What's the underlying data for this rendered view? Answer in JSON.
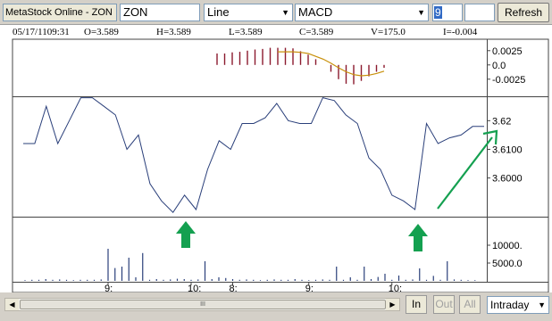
{
  "toolbar": {
    "app_title": "MetaStock Online - ZON",
    "symbol": "ZON",
    "chart_type": "Line",
    "indicator": "MACD",
    "period": "9",
    "refresh_label": "Refresh"
  },
  "info": {
    "datetime": "05/17/1109:31",
    "open": "O=3.589",
    "high": "H=3.589",
    "low": "L=3.589",
    "close": "C=3.589",
    "volume": "V=175.0",
    "indicator_value": "I=-0.004"
  },
  "icons": {
    "dropdown": "▼",
    "scroll_left": "◀",
    "scroll_right": "▶",
    "thumb_grip": "III"
  },
  "colors": {
    "macd_bars": "#8b1a2e",
    "signal_line": "#c8900a",
    "price_line": "#2a3f7a",
    "volume_bars": "#2a3f7a",
    "arrow_green": "#14a050"
  },
  "chart_data": [
    {
      "type": "bar",
      "panel": "MACD",
      "ylabels": [
        "0.0025",
        "0.0",
        "-0.0025"
      ],
      "yticks": [
        0.0025,
        0,
        -0.0025
      ],
      "ylim": [
        -0.0055,
        0.0045
      ],
      "x": [
        26,
        27,
        28,
        29,
        30,
        31,
        32,
        33,
        34,
        35,
        36,
        37,
        38,
        39,
        40,
        41,
        42,
        43,
        44,
        45,
        46,
        47,
        48
      ],
      "histogram": [
        0.002,
        0.002,
        0.0022,
        0.0023,
        0.0025,
        0.0027,
        0.0028,
        0.003,
        0.003,
        0.003,
        0.0029,
        0.0024,
        0.0018,
        0.001,
        0,
        -0.0012,
        -0.0025,
        -0.0033,
        -0.0034,
        -0.0028,
        -0.002,
        -0.0012,
        -0.0005
      ],
      "signal": [
        0.0023,
        0.0023,
        0.0023,
        0.0022,
        0.002,
        0.0015,
        0.001,
        0.0003,
        -0.0005,
        -0.0012,
        -0.0017,
        -0.0019,
        -0.0018,
        -0.0015,
        -0.0011
      ]
    },
    {
      "type": "line",
      "panel": "Price",
      "ylabels": [
        "3.62",
        "3.6100",
        "3.6000"
      ],
      "yticks": [
        3.62,
        3.61,
        3.6
      ],
      "ylim": [
        3.5865,
        3.6285
      ],
      "values": [
        3.612,
        3.612,
        3.625,
        3.612,
        3.62,
        3.628,
        3.628,
        3.625,
        3.622,
        3.61,
        3.615,
        3.598,
        3.592,
        3.588,
        3.594,
        3.589,
        3.603,
        3.613,
        3.61,
        3.619,
        3.619,
        3.621,
        3.626,
        3.62,
        3.619,
        3.619,
        3.628,
        3.627,
        3.622,
        3.619,
        3.607,
        3.603,
        3.594,
        3.592,
        3.589,
        3.619,
        3.612,
        3.614,
        3.615,
        3.618,
        3.618
      ],
      "trend_annotation": "uptrend-arrow"
    },
    {
      "type": "bar",
      "panel": "Volume",
      "ylabels": [
        "10000.",
        "5000.0"
      ],
      "yticks": [
        10000,
        5000
      ],
      "ylim": [
        0,
        18000
      ],
      "values": [
        200,
        300,
        300,
        500,
        300,
        400,
        300,
        200,
        300,
        300,
        300,
        400,
        9000,
        3600,
        4000,
        6500,
        1000,
        7800,
        300,
        500,
        300,
        400,
        600,
        500,
        300,
        400,
        5500,
        500,
        1000,
        800,
        500,
        300,
        400,
        300,
        200,
        300,
        400,
        300,
        300,
        500,
        300,
        200,
        300,
        400,
        300,
        4000,
        300,
        1000,
        300,
        4000,
        500,
        1100,
        2000,
        300,
        1500,
        300,
        400,
        3500,
        300,
        1400,
        300,
        5500,
        400,
        300,
        200,
        200
      ],
      "xlabels": [
        {
          "label": "9:",
          "i": 12
        },
        {
          "label": "10:",
          "i": 24
        },
        {
          "label": "8:",
          "i": 30
        },
        {
          "label": "9:",
          "i": 41
        },
        {
          "label": "10:",
          "i": 53
        }
      ]
    }
  ],
  "bottom": {
    "zoom_in": "In",
    "zoom_out": "Out",
    "zoom_all": "All",
    "interval": "Intraday"
  }
}
